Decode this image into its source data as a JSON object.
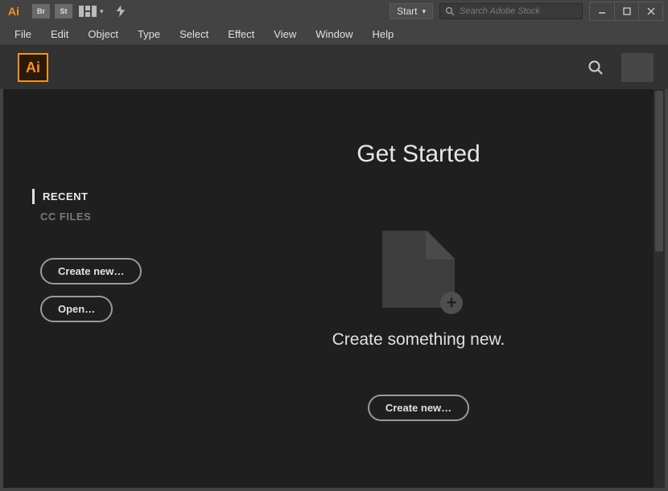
{
  "titlebar": {
    "app_badge": "Ai",
    "bridge_badge": "Br",
    "stock_badge": "St",
    "workspace_label": "Start",
    "search_placeholder": "Search Adobe Stock"
  },
  "menubar": {
    "items": [
      "File",
      "Edit",
      "Object",
      "Type",
      "Select",
      "Effect",
      "View",
      "Window",
      "Help"
    ]
  },
  "header": {
    "logo_text": "Ai"
  },
  "sidebar": {
    "tabs": [
      {
        "label": "RECENT",
        "active": true
      },
      {
        "label": "CC FILES",
        "active": false
      }
    ],
    "create_label": "Create new…",
    "open_label": "Open…"
  },
  "main": {
    "heading": "Get Started",
    "subtitle": "Create something new.",
    "create_label": "Create new…"
  }
}
